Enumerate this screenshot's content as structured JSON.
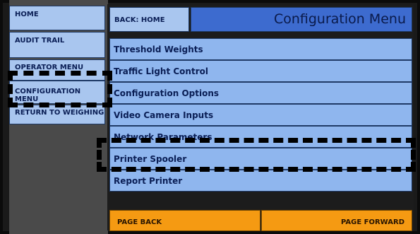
{
  "sidebar": {
    "items": [
      {
        "label": "HOME"
      },
      {
        "label": "AUDIT TRAIL"
      },
      {
        "label": "OPERATOR MENU"
      },
      {
        "label": "CONFIGURATION MENU"
      },
      {
        "label": "RETURN TO WEIGHING"
      }
    ]
  },
  "header": {
    "back_label": "BACK: HOME",
    "title": "Configuration Menu"
  },
  "menu": {
    "items": [
      {
        "label": "Threshold Weights"
      },
      {
        "label": "Traffic Light Control"
      },
      {
        "label": "Configuration Options"
      },
      {
        "label": "Video Camera Inputs"
      },
      {
        "label": "Network Parameters"
      },
      {
        "label": "Printer Spooler"
      },
      {
        "label": "Report Printer"
      }
    ]
  },
  "footer": {
    "page_back_label": "PAGE BACK",
    "page_forward_label": "PAGE FORWARD"
  },
  "colors": {
    "button_blue": "#a9c6ef",
    "title_blue": "#3d6bcf",
    "page_orange": "#f59a12",
    "sidebar_gray": "#4a4a4a",
    "background_dark": "#1c1c1c"
  }
}
